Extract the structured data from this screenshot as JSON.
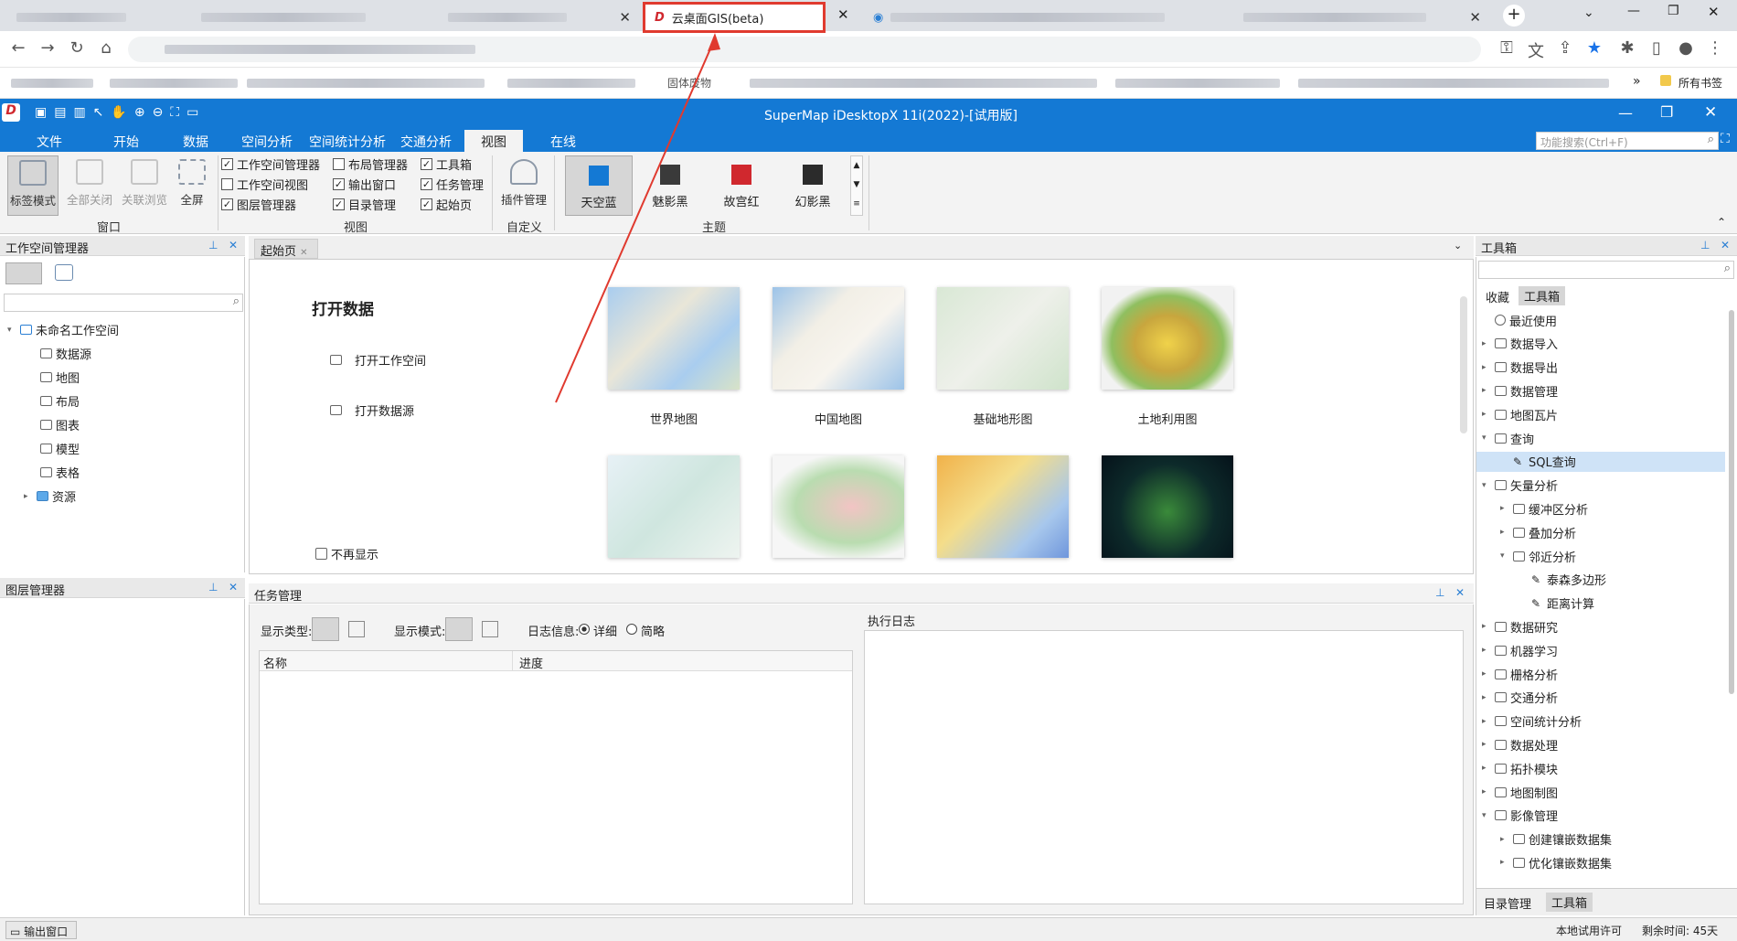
{
  "browser": {
    "active_tab_title": "云桌面GIS(beta)",
    "bookmarks_folder": "所有书签",
    "bookmark_partial": "固体废物"
  },
  "app": {
    "title": "SuperMap iDesktopX 11i(2022)-[试用版]",
    "search_placeholder": "功能搜索(Ctrl+F)",
    "menus": [
      "文件",
      "开始",
      "数据",
      "空间分析",
      "空间统计分析",
      "交通分析",
      "视图",
      "在线"
    ],
    "ribbon": {
      "window_group": "窗口",
      "view_group": "视图",
      "custom_group": "自定义",
      "theme_group": "主题",
      "window_buttons": [
        "标签模式",
        "全部关闭",
        "关联浏览",
        "全屏"
      ],
      "view_checks": [
        [
          "工作空间管理器",
          "布局管理器",
          "工具箱"
        ],
        [
          "工作空间视图",
          "输出窗口",
          "任务管理"
        ],
        [
          "图层管理器",
          "目录管理",
          "起始页"
        ]
      ],
      "plugin_button": "插件管理",
      "themes": [
        {
          "label": "天空蓝",
          "color": "#1479d4"
        },
        {
          "label": "魅影黑",
          "color": "#3a3a3a"
        },
        {
          "label": "故宫红",
          "color": "#d0282e"
        },
        {
          "label": "幻影黑",
          "color": "#2b2b2b"
        }
      ]
    },
    "workspace_panel": {
      "title": "工作空间管理器",
      "root": "未命名工作空间",
      "items": [
        "数据源",
        "地图",
        "布局",
        "图表",
        "模型",
        "表格",
        "资源"
      ]
    },
    "layer_panel": {
      "title": "图层管理器"
    },
    "start_page": {
      "tab": "起始页",
      "heading": "打开数据",
      "links": [
        "打开工作空间",
        "打开数据源"
      ],
      "dont_show": "不再显示",
      "maps": [
        "世界地图",
        "中国地图",
        "基础地形图",
        "土地利用图"
      ]
    },
    "task_panel": {
      "title": "任务管理",
      "display_type": "显示类型:",
      "display_mode": "显示模式:",
      "log_info": "日志信息:",
      "detail": "详细",
      "brief": "简略",
      "col_name": "名称",
      "col_progress": "进度",
      "exec_log": "执行日志"
    },
    "toolbox": {
      "title": "工具箱",
      "tabs": [
        "收藏",
        "工具箱"
      ],
      "items": [
        {
          "label": "最近使用",
          "lvl": 0,
          "exp": "",
          "icon": "clock"
        },
        {
          "label": "数据导入",
          "lvl": 0,
          "exp": "▸",
          "icon": "box"
        },
        {
          "label": "数据导出",
          "lvl": 0,
          "exp": "▸",
          "icon": "box"
        },
        {
          "label": "数据管理",
          "lvl": 0,
          "exp": "▸",
          "icon": "box"
        },
        {
          "label": "地图瓦片",
          "lvl": 0,
          "exp": "▸",
          "icon": "box"
        },
        {
          "label": "查询",
          "lvl": 0,
          "exp": "▾",
          "icon": "box"
        },
        {
          "label": "SQL查询",
          "lvl": 1,
          "exp": "",
          "icon": "tool",
          "selected": true
        },
        {
          "label": "矢量分析",
          "lvl": 0,
          "exp": "▾",
          "icon": "box"
        },
        {
          "label": "缓冲区分析",
          "lvl": 1,
          "exp": "▸",
          "icon": "box"
        },
        {
          "label": "叠加分析",
          "lvl": 1,
          "exp": "▸",
          "icon": "box"
        },
        {
          "label": "邻近分析",
          "lvl": 1,
          "exp": "▾",
          "icon": "box"
        },
        {
          "label": "泰森多边形",
          "lvl": 2,
          "exp": "",
          "icon": "tool"
        },
        {
          "label": "距离计算",
          "lvl": 2,
          "exp": "",
          "icon": "tool"
        },
        {
          "label": "数据研究",
          "lvl": 0,
          "exp": "▸",
          "icon": "box"
        },
        {
          "label": "机器学习",
          "lvl": 0,
          "exp": "▸",
          "icon": "box"
        },
        {
          "label": "栅格分析",
          "lvl": 0,
          "exp": "▸",
          "icon": "box"
        },
        {
          "label": "交通分析",
          "lvl": 0,
          "exp": "▸",
          "icon": "box"
        },
        {
          "label": "空间统计分析",
          "lvl": 0,
          "exp": "▸",
          "icon": "box"
        },
        {
          "label": "数据处理",
          "lvl": 0,
          "exp": "▸",
          "icon": "box"
        },
        {
          "label": "拓扑模块",
          "lvl": 0,
          "exp": "▸",
          "icon": "box"
        },
        {
          "label": "地图制图",
          "lvl": 0,
          "exp": "▸",
          "icon": "box"
        },
        {
          "label": "影像管理",
          "lvl": 0,
          "exp": "▾",
          "icon": "box"
        },
        {
          "label": "创建镶嵌数据集",
          "lvl": 1,
          "exp": "▸",
          "icon": "box"
        },
        {
          "label": "优化镶嵌数据集",
          "lvl": 1,
          "exp": "▸",
          "icon": "box"
        }
      ],
      "bottom_tabs": [
        "目录管理",
        "工具箱"
      ]
    },
    "status": {
      "output_window": "输出窗口",
      "license": "本地试用许可",
      "remaining": "剩余时间: 45天"
    }
  }
}
